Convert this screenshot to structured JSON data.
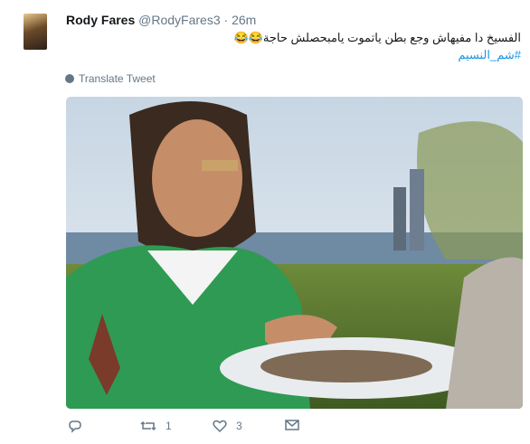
{
  "tweet": {
    "author_name": "Rody Fares",
    "author_handle": "@RodyFares3",
    "separator": "·",
    "time": "26m",
    "text": "الفسيخ دا مفيهاش وجع بطن ياتموت يامبحصلش حاجة😂😂",
    "hashtag": "#شم_النسيم",
    "translate_label": "Translate Tweet"
  },
  "actions": {
    "reply_count": "",
    "retweet_count": "1",
    "like_count": "3"
  },
  "icons": {
    "translate": "globe-icon",
    "reply": "reply-icon",
    "retweet": "retweet-icon",
    "like": "heart-icon",
    "message": "envelope-icon"
  },
  "colors": {
    "text": "#14171a",
    "secondary": "#657786",
    "link": "#1b95e0"
  }
}
